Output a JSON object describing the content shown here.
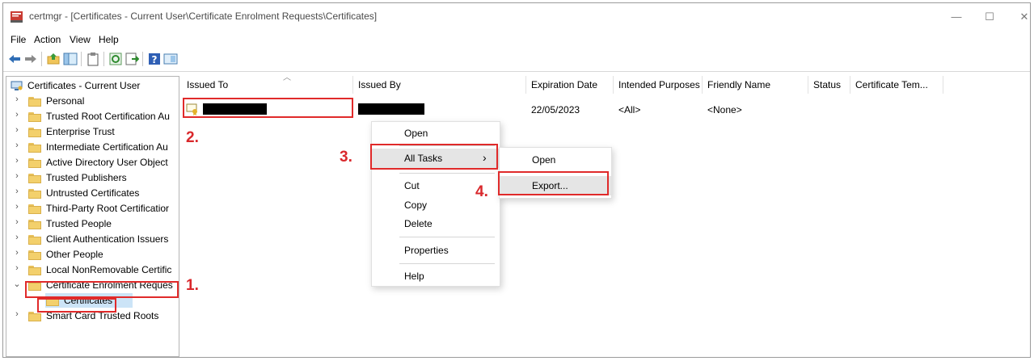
{
  "window": {
    "title": "certmgr - [Certificates - Current User\\Certificate Enrolment Requests\\Certificates]",
    "minimize_glyph": "—",
    "maximize_glyph": "☐",
    "close_glyph": "✕"
  },
  "menu": [
    "File",
    "Action",
    "View",
    "Help"
  ],
  "toolbar": {
    "icons": [
      "back-arrow-icon",
      "forward-arrow-icon",
      "up-folder-icon",
      "show-hide-tree-icon",
      "clipboard-icon",
      "refresh-icon",
      "export-list-icon",
      "help-icon",
      "properties-pane-icon"
    ]
  },
  "tree": {
    "root": "Certificates - Current User",
    "items": [
      {
        "label": "Personal",
        "expanded": false
      },
      {
        "label": "Trusted Root Certification Au",
        "expanded": false
      },
      {
        "label": "Enterprise Trust",
        "expanded": false
      },
      {
        "label": "Intermediate Certification Au",
        "expanded": false
      },
      {
        "label": "Active Directory User Object",
        "expanded": false
      },
      {
        "label": "Trusted Publishers",
        "expanded": false
      },
      {
        "label": "Untrusted Certificates",
        "expanded": false
      },
      {
        "label": "Third-Party Root Certificatior",
        "expanded": false
      },
      {
        "label": "Trusted People",
        "expanded": false
      },
      {
        "label": "Client Authentication Issuers",
        "expanded": false
      },
      {
        "label": "Other People",
        "expanded": false
      },
      {
        "label": "Local NonRemovable Certific",
        "expanded": false
      },
      {
        "label": "Certificate Enrolment Reques",
        "expanded": true
      },
      {
        "label": "Certificates",
        "child": true,
        "selected": true
      },
      {
        "label": "Smart Card Trusted Roots",
        "expanded": false
      }
    ]
  },
  "list": {
    "columns": [
      "Issued To",
      "Issued By",
      "Expiration Date",
      "Intended Purposes",
      "Friendly Name",
      "Status",
      "Certificate Tem..."
    ],
    "rows": [
      {
        "issued_to": "",
        "issued_by": "",
        "expiration": "22/05/2023",
        "purposes": "<All>",
        "friendly_name": "<None>",
        "status": "",
        "template": ""
      }
    ]
  },
  "context_menu": {
    "items": [
      "Open",
      "All Tasks",
      "Cut",
      "Copy",
      "Delete",
      "Properties",
      "Help"
    ],
    "submenu_arrow": "›",
    "submenu": [
      "Open",
      "Export..."
    ]
  },
  "annotations": {
    "steps": [
      "1.",
      "2.",
      "3.",
      "4."
    ],
    "color": "#e02a2a"
  }
}
